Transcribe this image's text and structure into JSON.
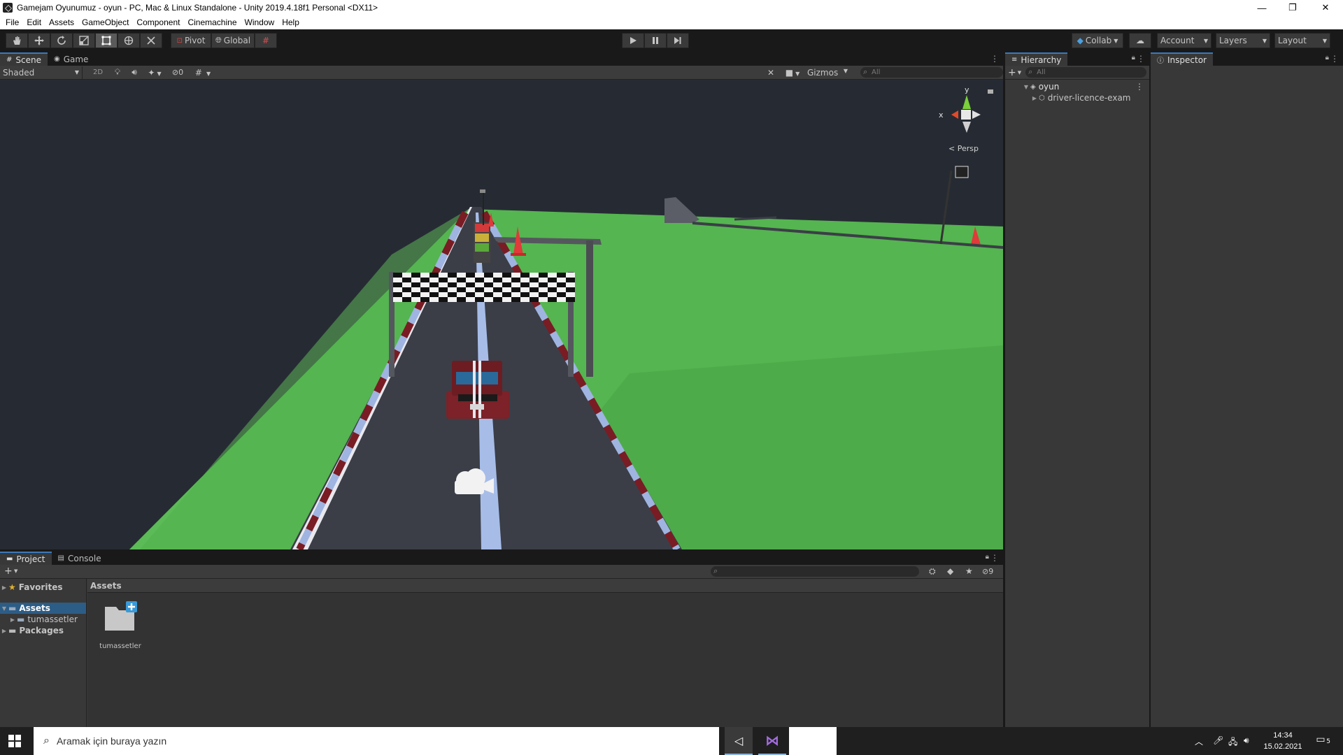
{
  "window": {
    "title": "Gamejam Oyunumuz - oyun - PC, Mac & Linux Standalone - Unity 2019.4.18f1 Personal <DX11>",
    "min_icon": "—",
    "max_icon": "❐",
    "close_icon": "✕"
  },
  "menu": [
    "File",
    "Edit",
    "Assets",
    "GameObject",
    "Component",
    "Cinemachine",
    "Window",
    "Help"
  ],
  "toolbar": {
    "pivot_label": "Pivot",
    "global_label": "Global",
    "collab_label": "Collab",
    "account_label": "Account",
    "layers_label": "Layers",
    "layout_label": "Layout"
  },
  "scene_panel": {
    "tabs": [
      {
        "label": "Scene",
        "icon": "grid-icon"
      },
      {
        "label": "Game",
        "icon": "gamepad-icon"
      }
    ],
    "draw_mode": "Shaded",
    "mode_2d": "2D",
    "hidden_count": "0",
    "gizmos_label": "Gizmos",
    "search_placeholder": "All",
    "gizmo_y": "y",
    "gizmo_x": "x",
    "persp_label": "< Persp"
  },
  "hierarchy": {
    "tab_label": "Hierarchy",
    "search_placeholder": "All",
    "scene_name": "oyun",
    "items": [
      {
        "label": "driver-licence-exam"
      }
    ]
  },
  "inspector": {
    "tab_label": "Inspector"
  },
  "project_panel": {
    "tabs": [
      {
        "label": "Project"
      },
      {
        "label": "Console"
      }
    ],
    "hidden_count": "9",
    "favorites_label": "Favorites",
    "tree": [
      {
        "label": "Assets",
        "level": 0,
        "selected": true
      },
      {
        "label": "tumassetler",
        "level": 1,
        "selected": false
      },
      {
        "label": "Packages",
        "level": 0,
        "selected": false
      }
    ],
    "breadcrumb": "Assets",
    "assets": [
      {
        "label": "tumassetler",
        "icon": "folder-icon"
      }
    ]
  },
  "taskbar": {
    "search_placeholder": "Aramak için buraya yazın",
    "time": "14:34",
    "date": "15.02.2021",
    "notification_count": "5"
  },
  "colors": {
    "accent": "#3a79bb",
    "grass": "#55b550",
    "road": "#3b3e47",
    "sky": "#262b33"
  }
}
